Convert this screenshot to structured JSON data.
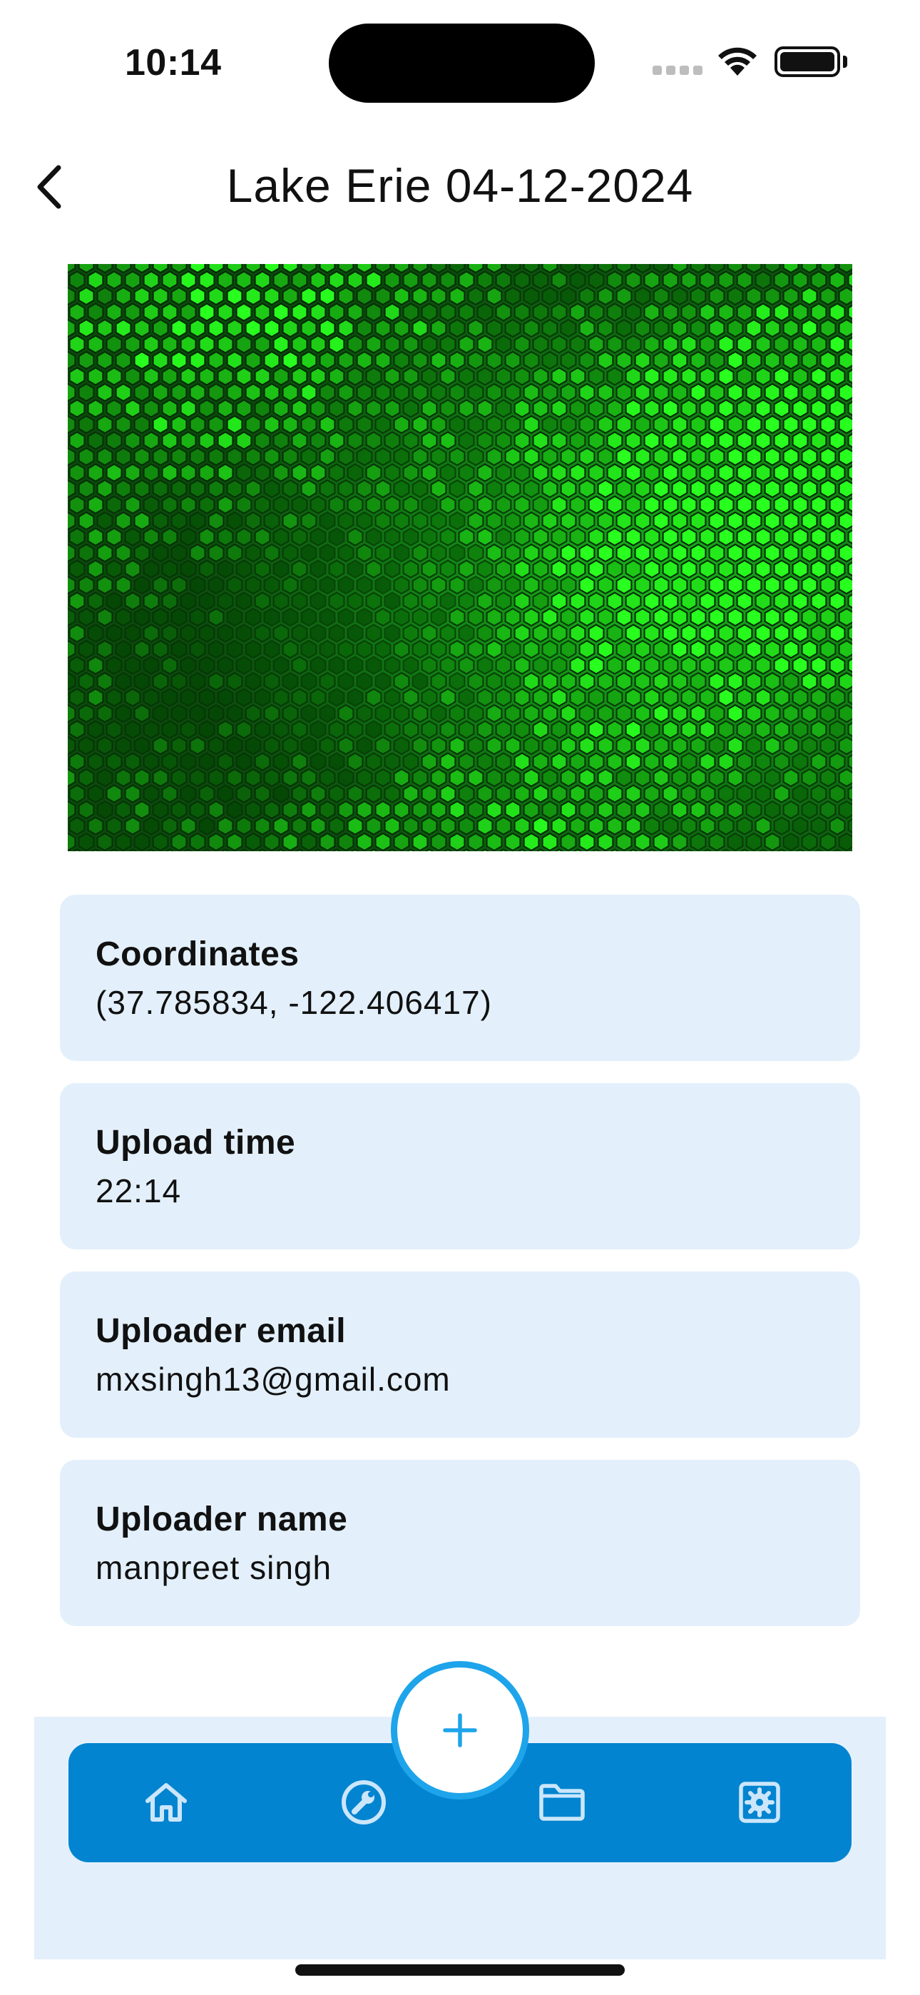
{
  "status_bar": {
    "time": "10:14"
  },
  "header": {
    "title": "Lake Erie 04-12-2024",
    "back_icon": "chevron-left-icon"
  },
  "photo": {
    "subject": "green hexagonal cell sample image"
  },
  "details": [
    {
      "label": "Coordinates",
      "value": "(37.785834, -122.406417)"
    },
    {
      "label": "Upload time",
      "value": "22:14"
    },
    {
      "label": "Uploader email",
      "value": "mxsingh13@gmail.com"
    },
    {
      "label": "Uploader name",
      "value": "manpreet singh"
    }
  ],
  "tab_bar": {
    "items": [
      {
        "icon": "home-icon"
      },
      {
        "icon": "wrench-icon"
      },
      {
        "icon": "folder-icon"
      },
      {
        "icon": "settings-icon"
      }
    ],
    "fab_icon": "plus-icon"
  },
  "colors": {
    "card_background": "#e3f0fb",
    "tab_bar": "#0284d0",
    "fab_ring": "#1ea4ea",
    "icon_light": "#cbe6fb"
  }
}
